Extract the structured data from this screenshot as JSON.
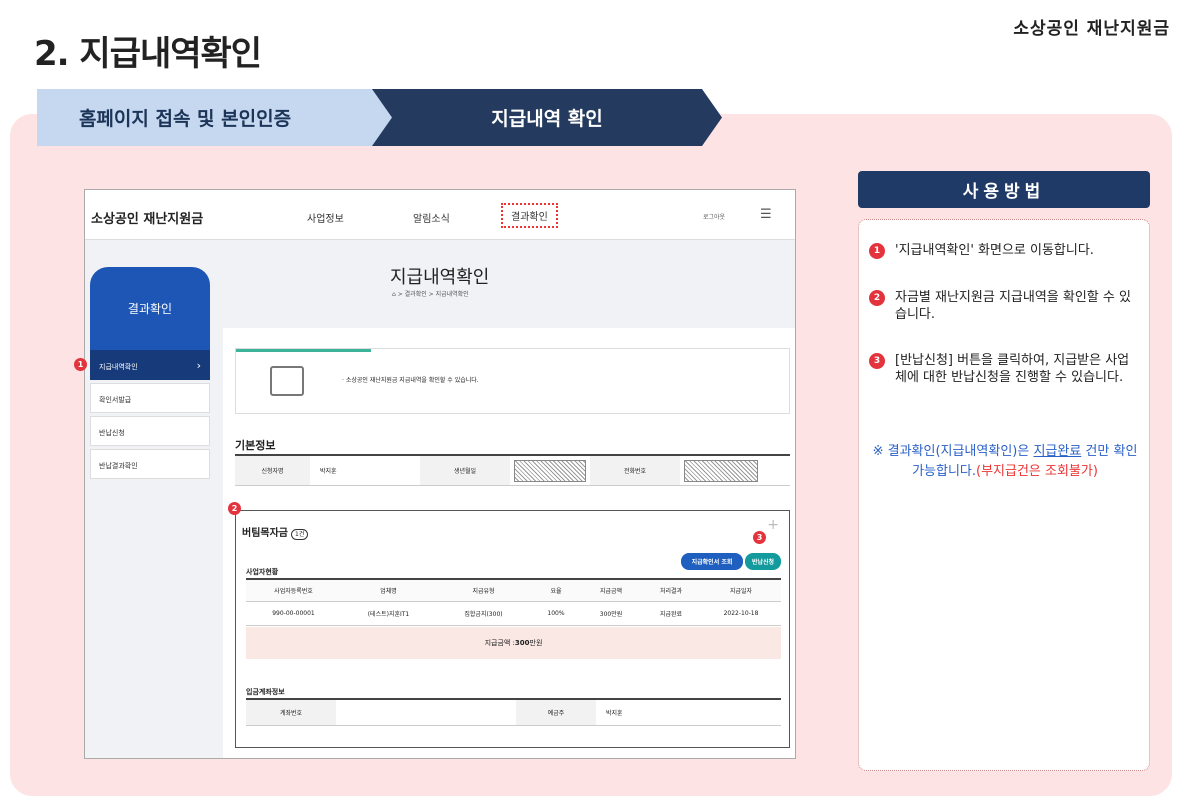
{
  "brand": "소상공인 재난지원금",
  "page_title": "2. 지급내역확인",
  "steps": {
    "step1": "홈페이지 접속 및 본인인증",
    "step2": "지급내역 확인"
  },
  "shot": {
    "logo": "소상공인 재난지원금",
    "nav": [
      "사업정보",
      "알림소식",
      "결과확인"
    ],
    "logout": "로그아웃",
    "side_title": "결과확인",
    "side_items": [
      "지급내역확인",
      "확인서발급",
      "반납신청",
      "반납결과확인"
    ],
    "inner_title": "지급내역확인",
    "breadcrumb": "⌂ > 결과확인 > 지급내역확인",
    "info_text": "· 소상공인 재난지원금 지급내역을 확인할 수 있습니다.",
    "basic": {
      "title": "기본정보",
      "applicant_label": "신청자명",
      "applicant_value": "박지훈",
      "birth_label": "생년월일",
      "phone_label": "전화번호"
    },
    "panel": {
      "title": "버팀목자금",
      "count": "1건",
      "sub": "사업자현황",
      "btn_cert": "지급확인서 조회",
      "btn_return": "반납신청",
      "headers": [
        "사업자등록번호",
        "업체명",
        "지급유형",
        "요율",
        "지급금액",
        "처리결과",
        "지급일자"
      ],
      "row": [
        "990-00-00001",
        "(테스트)지훈IT1",
        "집합금지(300)",
        "100%",
        "300만원",
        "지급완료",
        "2022-10-18"
      ],
      "sum_label": "지급금액 :",
      "sum_value": "300",
      "sum_unit": "만원",
      "account_title": "입금계좌정보",
      "account_label": "계좌번호",
      "holder_label": "예금주",
      "holder_value": "박지훈"
    }
  },
  "how": {
    "title": "사용방법",
    "items": [
      {
        "num": "1",
        "text": "'지급내역확인' 화면으로 이동합니다."
      },
      {
        "num": "2",
        "text": "자금별 재난지원금 지급내역을 확인할 수 있습니다."
      },
      {
        "num": "3",
        "text": "[반납신청] 버튼을 클릭하여, 지급받은 사업체에 대한 반납신청을 진행할 수 있습니다."
      }
    ],
    "note_a": "※ 결과확인(지급내역확인)은 ",
    "note_b": "지급완료",
    "note_c": " 건만 확인 가능합니다.",
    "note_d": "(부지급건은 조회불가)"
  },
  "callouts": [
    "1",
    "2",
    "3"
  ]
}
